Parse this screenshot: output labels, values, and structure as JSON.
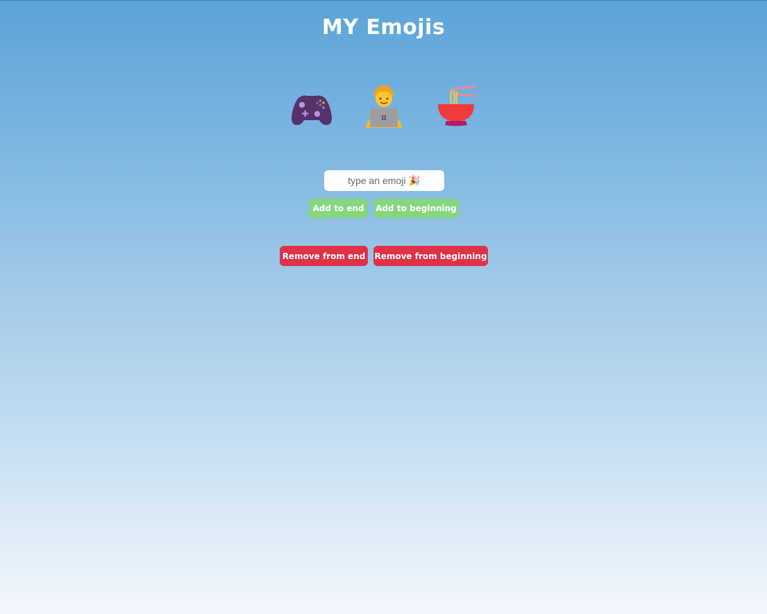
{
  "page": {
    "title": "MY Emojis"
  },
  "emojis": [
    {
      "name": "video-game-controller",
      "icon": "gamepad-icon"
    },
    {
      "name": "man-technologist",
      "icon": "technologist-icon"
    },
    {
      "name": "steaming-bowl",
      "icon": "noodle-bowl-icon"
    }
  ],
  "input": {
    "placeholder": "type an emoji 🎉",
    "value": ""
  },
  "buttons": {
    "add_end": "Add to end",
    "add_beginning": "Add to beginning",
    "remove_end": "Remove from end",
    "remove_beginning": "Remove from beginning"
  },
  "colors": {
    "add_button": "#85d67d",
    "remove_button": "#e03146",
    "title_text": "#ffffff"
  }
}
